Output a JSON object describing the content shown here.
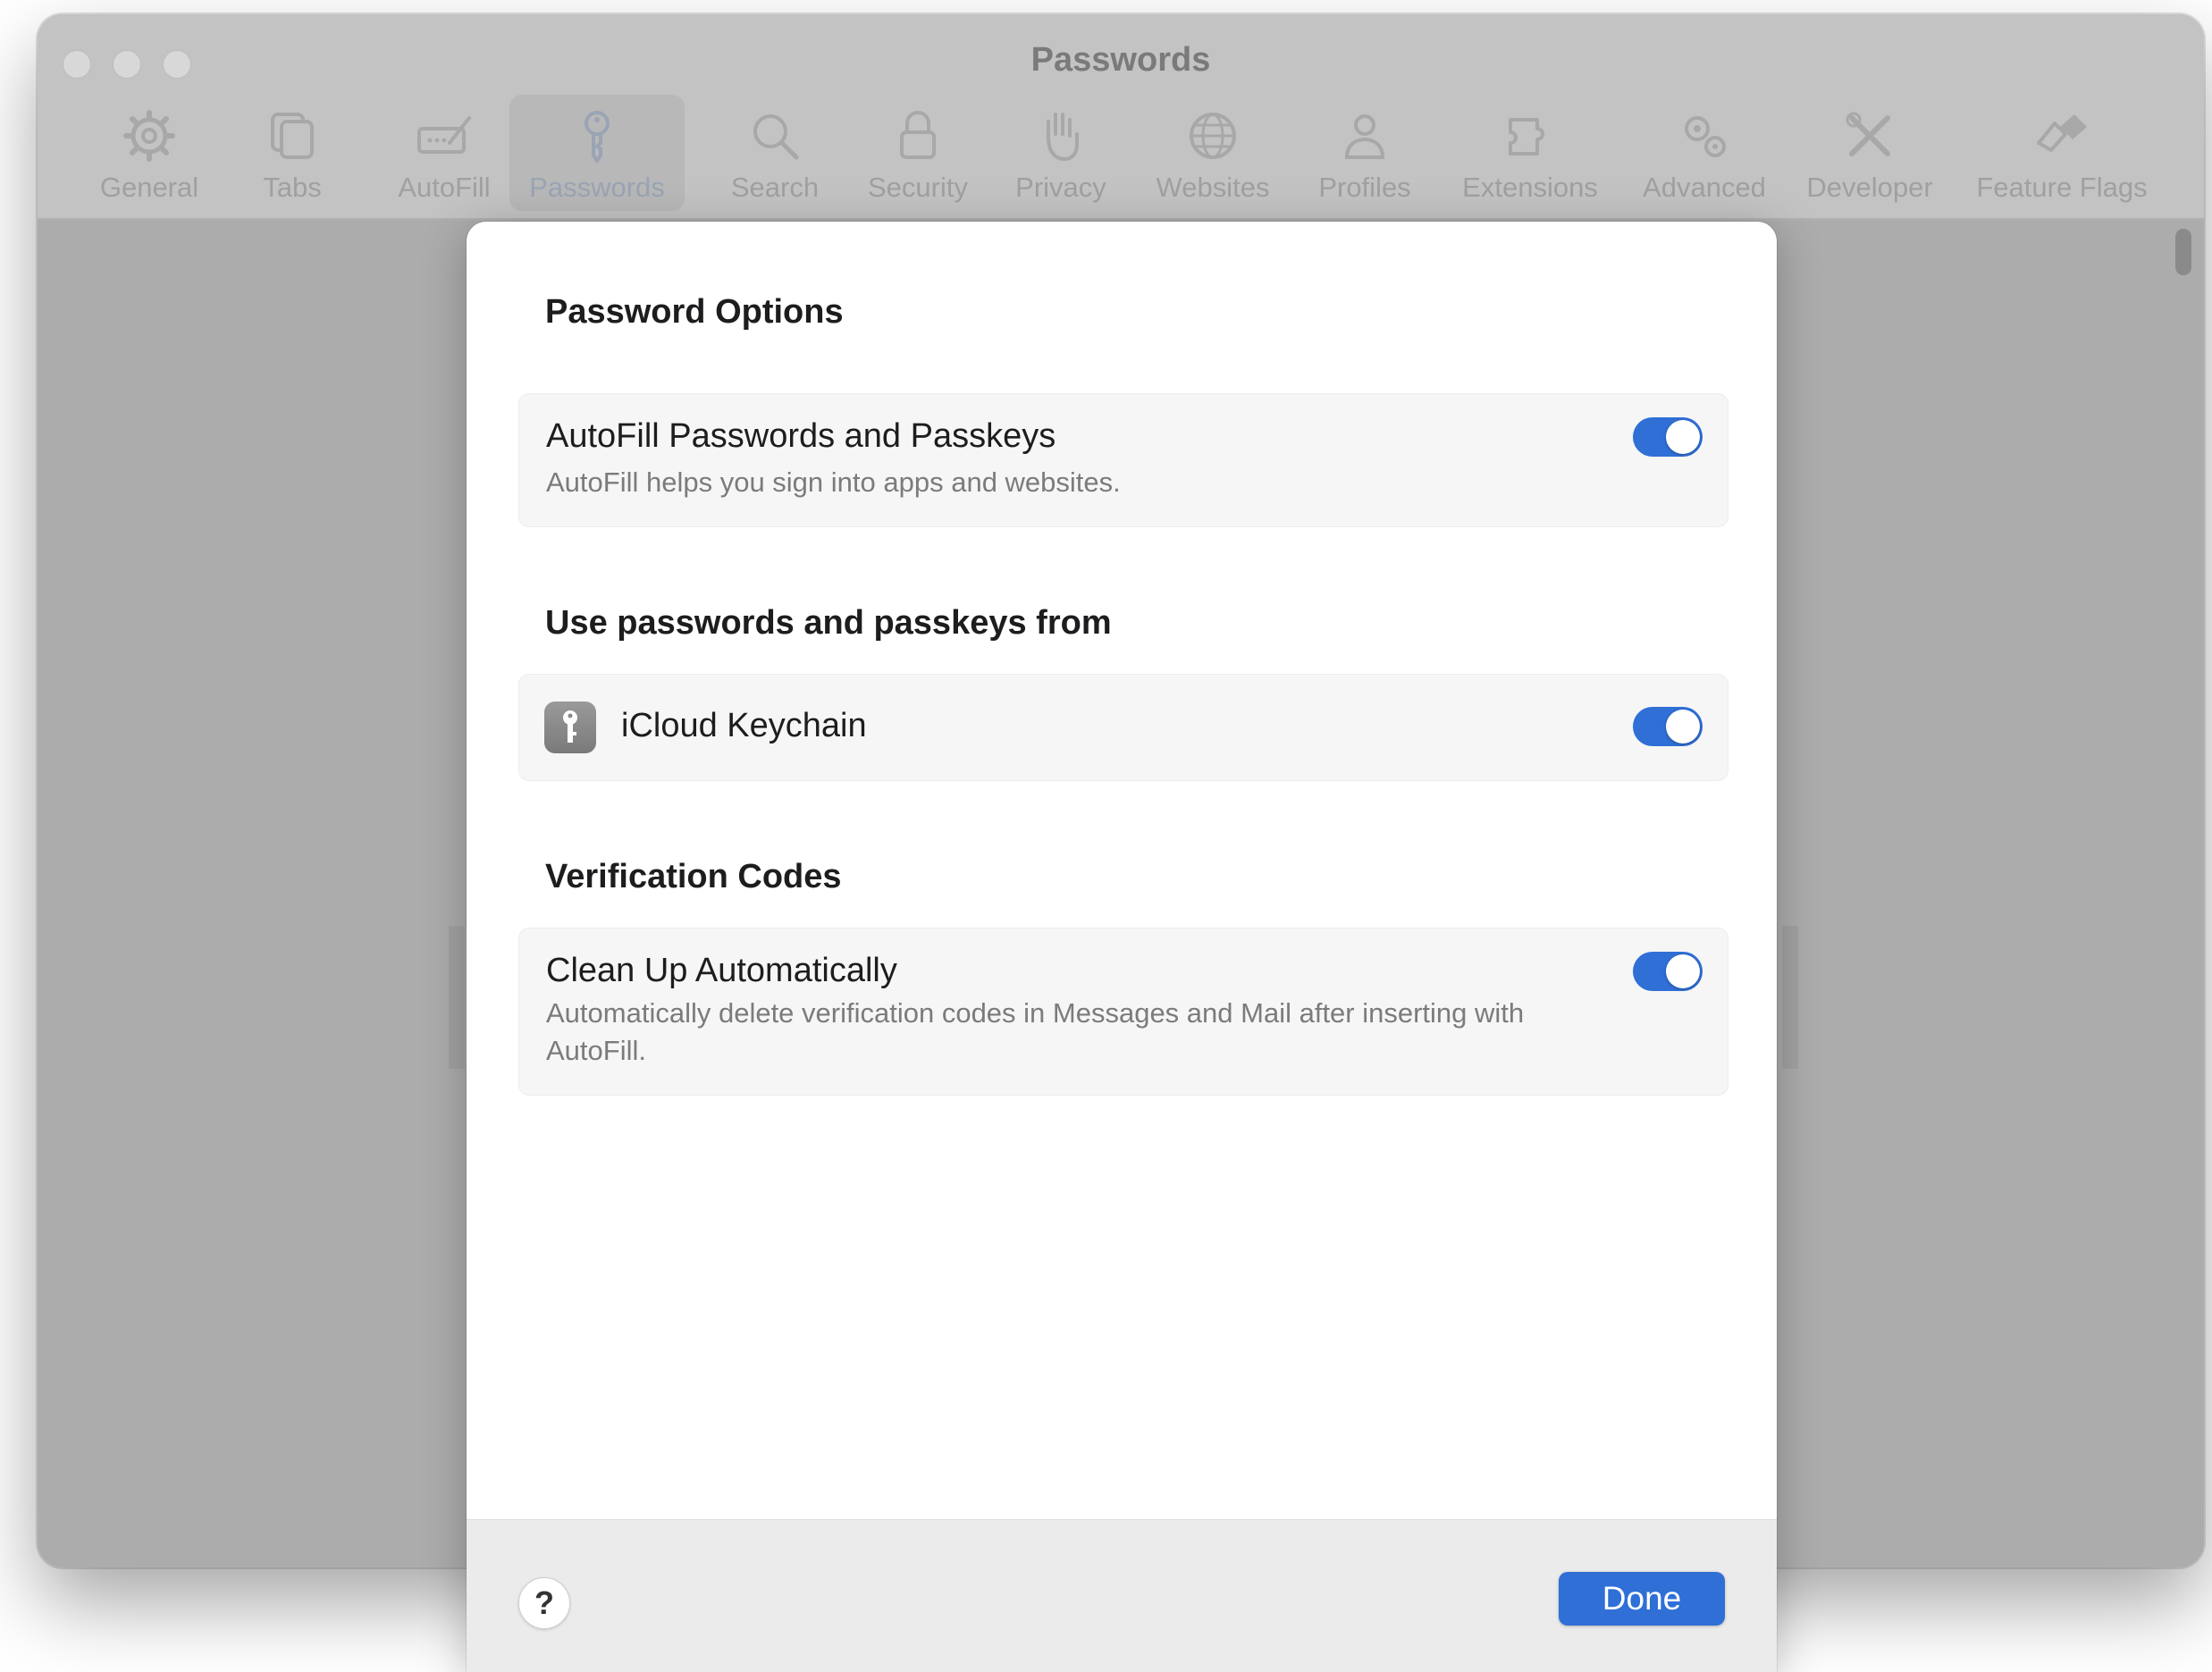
{
  "window": {
    "title": "Passwords"
  },
  "toolbar": {
    "items": [
      {
        "label": "General",
        "icon": "gear-icon"
      },
      {
        "label": "Tabs",
        "icon": "tabs-icon"
      },
      {
        "label": "AutoFill",
        "icon": "autofill-icon"
      },
      {
        "label": "Passwords",
        "icon": "key-icon",
        "selected": true
      },
      {
        "label": "Search",
        "icon": "search-icon"
      },
      {
        "label": "Security",
        "icon": "lock-icon"
      },
      {
        "label": "Privacy",
        "icon": "hand-icon"
      },
      {
        "label": "Websites",
        "icon": "globe-icon"
      },
      {
        "label": "Profiles",
        "icon": "person-icon"
      },
      {
        "label": "Extensions",
        "icon": "puzzle-icon"
      },
      {
        "label": "Advanced",
        "icon": "gears-icon"
      },
      {
        "label": "Developer",
        "icon": "tools-icon"
      },
      {
        "label": "Feature Flags",
        "icon": "flags-icon"
      }
    ]
  },
  "sheet": {
    "sections": [
      {
        "title": "Password Options",
        "rows": [
          {
            "title": "AutoFill Passwords and Passkeys",
            "description": "AutoFill helps you sign into apps and websites.",
            "toggle_on": true
          }
        ]
      },
      {
        "title": "Use passwords and passkeys from",
        "rows": [
          {
            "title": "iCloud Keychain",
            "icon": "keychain-icon",
            "toggle_on": true
          }
        ]
      },
      {
        "title": "Verification Codes",
        "rows": [
          {
            "title": "Clean Up Automatically",
            "description": "Automatically delete verification codes in Messages and Mail after inserting with AutoFill.",
            "toggle_on": true
          }
        ]
      }
    ],
    "footer": {
      "help_label": "?",
      "done_label": "Done"
    }
  },
  "colors": {
    "accent": "#2f6fd6",
    "window_bg": "#acacac",
    "toolbar_bg": "#c3c3c3"
  }
}
